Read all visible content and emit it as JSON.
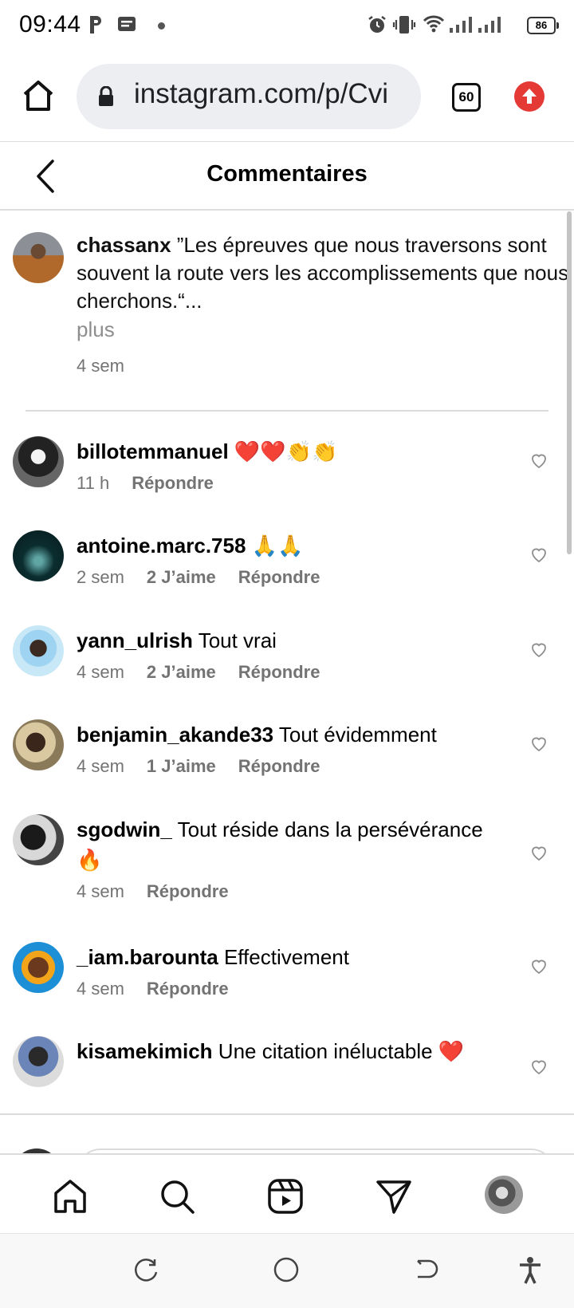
{
  "status_bar": {
    "time": "09:44",
    "battery": "86",
    "icons": [
      "parking-icon",
      "message-icon",
      "alarm-icon",
      "vibrate-icon",
      "wifi-icon",
      "signal-icon"
    ]
  },
  "browser": {
    "url": "instagram.com/p/Cvi",
    "tab_count": "60"
  },
  "header": {
    "title": "Commentaires"
  },
  "caption": {
    "user": "chassanx",
    "text": " ”Les épreuves que nous traversons sont souvent la route vers les accomplissements que nous cherchons.“...",
    "more": "plus",
    "time": "4 sem"
  },
  "comments": [
    {
      "user": "billotemmanuel",
      "text": " ❤️❤️👏👏",
      "time": "11 h",
      "likes": "",
      "reply": "Répondre"
    },
    {
      "user": "antoine.marc.758",
      "text": " 🙏🙏",
      "time": "2 sem",
      "likes": "2 J’aime",
      "reply": "Répondre"
    },
    {
      "user": "yann_ulrish",
      "text": " Tout vrai",
      "time": "4 sem",
      "likes": "2 J’aime",
      "reply": "Répondre"
    },
    {
      "user": "benjamin_akande33",
      "text": " Tout évidemment",
      "time": "4 sem",
      "likes": "1 J’aime",
      "reply": "Répondre"
    },
    {
      "user": "sgodwin_",
      "text": " Tout réside dans la persévérance 🔥",
      "time": "4 sem",
      "likes": "",
      "reply": "Répondre"
    },
    {
      "user": "_iam.barounta",
      "text": " Effectivement",
      "time": "4 sem",
      "likes": "",
      "reply": "Répondre"
    },
    {
      "user": "kisamekimich",
      "text": " Une citation inéluctable ❤️",
      "time": "",
      "likes": "",
      "reply": ""
    }
  ],
  "bottom_nav": [
    "home-icon",
    "search-icon",
    "reels-icon",
    "direct-icon",
    "profile-avatar"
  ],
  "colors": {
    "accent_red": "#e53935",
    "muted_text": "#737373",
    "divider": "#dbdbdb"
  }
}
